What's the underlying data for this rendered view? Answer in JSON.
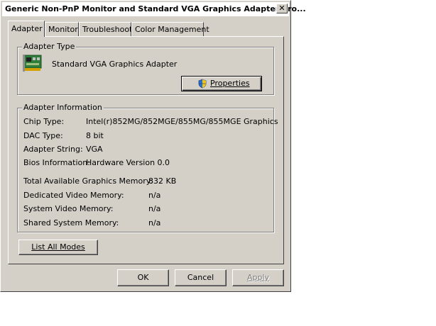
{
  "window": {
    "title": "Generic Non-PnP Monitor and Standard VGA Graphics Adapter Pro...",
    "close_glyph": "✕"
  },
  "tabs": [
    {
      "label": "Adapter",
      "active": true
    },
    {
      "label": "Monitor",
      "active": false
    },
    {
      "label": "Troubleshoot",
      "active": false
    },
    {
      "label": "Color Management",
      "active": false
    }
  ],
  "adapter_type": {
    "legend": "Adapter Type",
    "icon": "graphics-card-icon",
    "name": "Standard VGA Graphics Adapter",
    "properties_label": "Properties",
    "properties_icon": "shield-icon"
  },
  "adapter_info": {
    "legend": "Adapter Information",
    "rows": [
      {
        "label": "Chip Type:",
        "value": "Intel(r)852MG/852MGE/855MG/855MGE Graphics"
      },
      {
        "label": "DAC Type:",
        "value": "8 bit"
      },
      {
        "label": "Adapter String:",
        "value": "VGA"
      },
      {
        "label": "Bios Information:",
        "value": "Hardware Version 0.0"
      }
    ],
    "memory_rows": [
      {
        "label": "Total Available Graphics Memory:",
        "value": "832 KB"
      },
      {
        "label": "Dedicated Video Memory:",
        "value": "n/a"
      },
      {
        "label": "System Video Memory:",
        "value": "n/a"
      },
      {
        "label": "Shared System Memory:",
        "value": "n/a"
      }
    ]
  },
  "list_all_modes_label": "List All Modes",
  "footer": {
    "ok_label": "OK",
    "cancel_label": "Cancel",
    "apply_label": "Apply"
  }
}
